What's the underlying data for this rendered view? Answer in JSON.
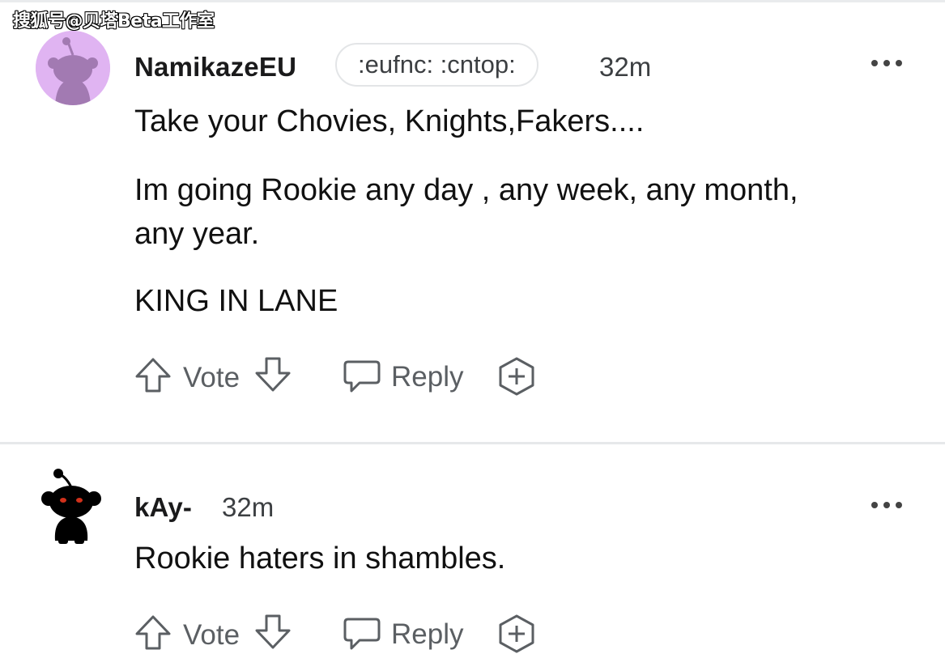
{
  "watermark": "搜狐号@贝塔Beta工作室",
  "comments": [
    {
      "author": "NamikazeEU",
      "flair": ":eufnc: :cntop:",
      "time": "32m",
      "paragraphs": [
        "Take your Chovies, Knights,Fakers....",
        "Im going Rookie any day , any week, any month,",
        "any year.",
        "KING IN LANE"
      ],
      "vote_label": "Vote",
      "reply_label": "Reply"
    },
    {
      "author": "kAy-",
      "time": "32m",
      "paragraphs": [
        "Rookie haters in shambles."
      ],
      "vote_label": "Vote",
      "reply_label": "Reply"
    }
  ],
  "icons": {
    "more": "more-options-icon",
    "upvote": "upvote-arrow-icon",
    "downvote": "downvote-arrow-icon",
    "reply": "reply-bubble-icon",
    "award": "award-plus-icon"
  },
  "colors": {
    "avatar_purple": "#e0b4f2",
    "text": "#111111",
    "muted": "#5b5f63"
  }
}
